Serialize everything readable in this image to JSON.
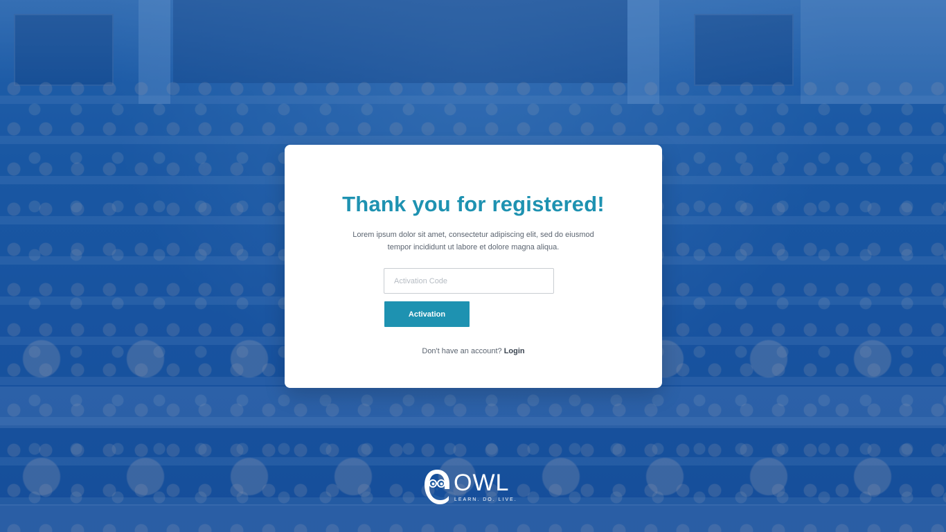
{
  "card": {
    "title": "Thank you for registered!",
    "description_line1": "Lorem ipsum dolor sit amet, consectetur adipiscing elit, sed do eiusmod",
    "description_line2": "tempor incididunt ut labore et dolore magna aliqua.",
    "activation_input": {
      "placeholder": "Activation Code",
      "value": ""
    },
    "activation_button_label": "Activation",
    "no_account_text": "Don't have an account?",
    "login_link_label": "Login"
  },
  "logo": {
    "wordmark": "OWL",
    "tagline": "LEARN. DO. LIVE.",
    "icon": "owl-icon"
  },
  "background": {
    "icon": "lecture-hall-photo"
  },
  "colors": {
    "accent": "#1e92b1",
    "background_tint": "#1f5ea3",
    "card": "#ffffff",
    "body_text": "#5b6470"
  }
}
